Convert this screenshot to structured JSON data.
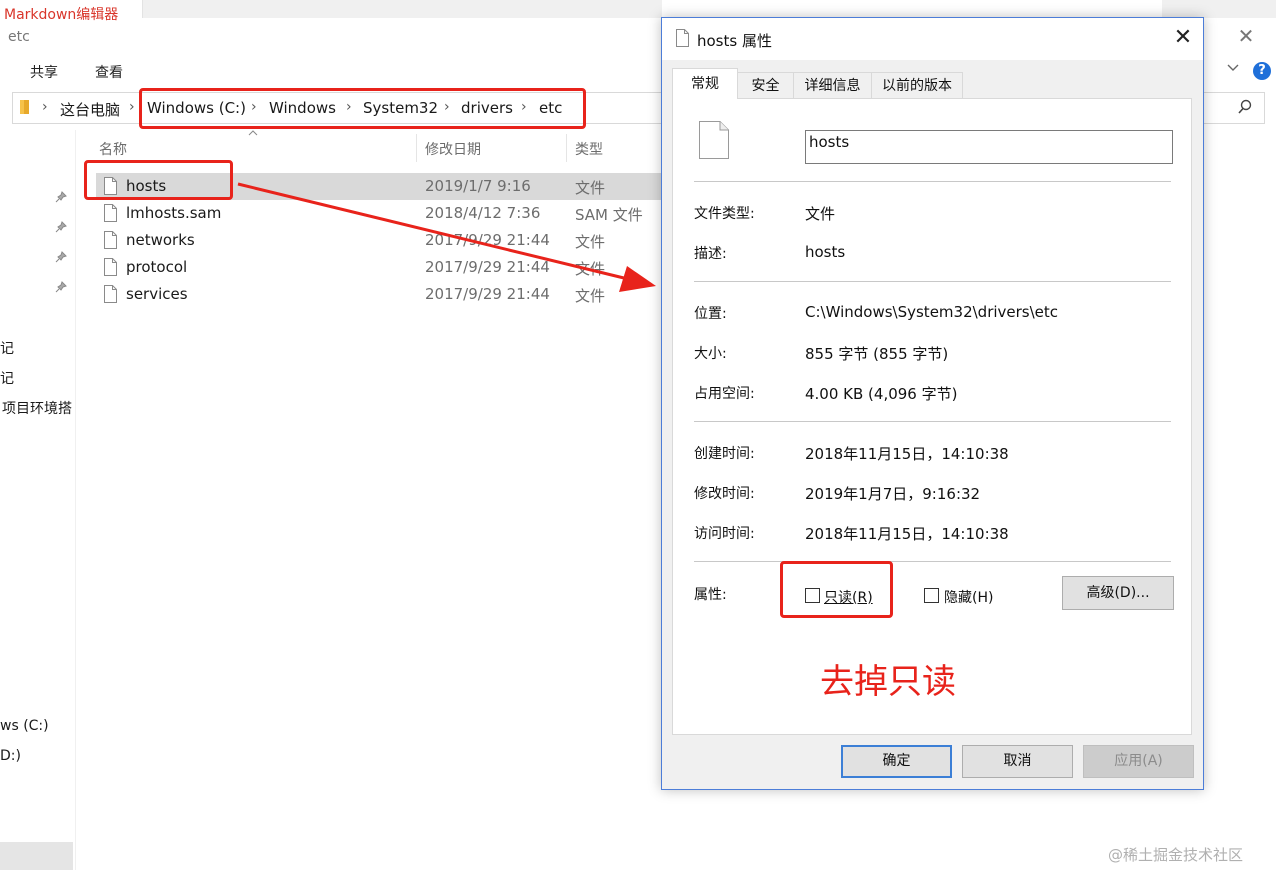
{
  "background_app": {
    "title": "Markdown编辑器"
  },
  "explorer": {
    "window_title": "etc",
    "close_glyph": "✕",
    "ribbon_tabs": [
      "共享",
      "查看"
    ],
    "breadcrumb": {
      "separator": "›",
      "items": [
        "这台电脑",
        "Windows (C:)",
        "Windows",
        "System32",
        "drivers",
        "etc"
      ]
    },
    "columns": {
      "name": "名称",
      "modified": "修改日期",
      "type": "类型"
    },
    "files": [
      {
        "name": "hosts",
        "date": "2019/1/7 9:16",
        "type": "文件",
        "selected": true
      },
      {
        "name": "lmhosts.sam",
        "date": "2018/4/12 7:36",
        "type": "SAM 文件"
      },
      {
        "name": "networks",
        "date": "2017/9/29 21:44",
        "type": "文件"
      },
      {
        "name": "protocol",
        "date": "2017/9/29 21:44",
        "type": "文件"
      },
      {
        "name": "services",
        "date": "2017/9/29 21:44",
        "type": "文件"
      }
    ],
    "sidebar_items": [
      "笔记",
      "笔记",
      "项目环境搭",
      "ws (C:)",
      "D:)"
    ],
    "help_glyph": "?"
  },
  "dialog": {
    "title": "hosts 属性",
    "close_glyph": "✕",
    "tabs": [
      "常规",
      "安全",
      "详细信息",
      "以前的版本"
    ],
    "file_name": "hosts",
    "file_type_label": "文件类型:",
    "file_type_value": "文件",
    "description_label": "描述:",
    "description_value": "hosts",
    "location_label": "位置:",
    "location_value": "C:\\Windows\\System32\\drivers\\etc",
    "size_label": "大小:",
    "size_value": "855 字节 (855 字节)",
    "disk_size_label": "占用空间:",
    "disk_size_value": "4.00 KB (4,096 字节)",
    "created_label": "创建时间:",
    "created_value": "2018年11月15日，14:10:38",
    "modified_label": "修改时间:",
    "modified_value": "2019年1月7日，9:16:32",
    "accessed_label": "访问时间:",
    "accessed_value": "2018年11月15日，14:10:38",
    "attributes_label": "属性:",
    "readonly_label": "只读(R)",
    "readonly_checked": false,
    "hidden_label": "隐藏(H)",
    "hidden_checked": false,
    "advanced_label": "高级(D)...",
    "ok_label": "确定",
    "cancel_label": "取消",
    "apply_label": "应用(A)"
  },
  "annotation": {
    "text": "去掉只读",
    "color": "#e8231b"
  },
  "watermark": "@稀土掘金技术社区"
}
